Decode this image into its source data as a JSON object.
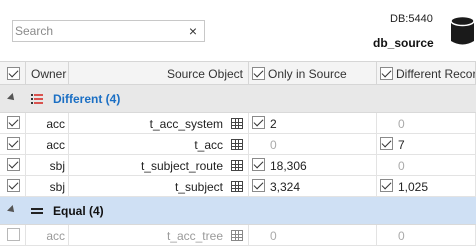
{
  "search": {
    "placeholder": "Search",
    "value": "",
    "clear_label": "×"
  },
  "database": {
    "port_label": "DB:5440",
    "name": "db_source"
  },
  "columns": {
    "owner": "Owner",
    "source_object": "Source Object",
    "only_in_source": "Only in Source",
    "different_records": "Different Records"
  },
  "groups": [
    {
      "label": "Different (4)",
      "rows": [
        {
          "owner": "acc",
          "object": "t_acc_system",
          "only_in_source": "2",
          "different_records": "0",
          "checked": true
        },
        {
          "owner": "acc",
          "object": "t_acc",
          "only_in_source": "0",
          "different_records": "7",
          "checked": true
        },
        {
          "owner": "sbj",
          "object": "t_subject_route",
          "only_in_source": "18,306",
          "different_records": "0",
          "checked": true
        },
        {
          "owner": "sbj",
          "object": "t_subject",
          "only_in_source": "3,324",
          "different_records": "1,025",
          "checked": true
        }
      ]
    },
    {
      "label": "Equal (4)",
      "rows": [
        {
          "owner": "acc",
          "object": "t_acc_tree",
          "only_in_source": "0",
          "different_records": "0",
          "checked": false
        }
      ]
    }
  ],
  "colors": {
    "accent": "#1b6fc4",
    "selected_group": "#cfe0f4",
    "group_bg": "#e8e8e8",
    "diff_icon": "#d9534f"
  }
}
